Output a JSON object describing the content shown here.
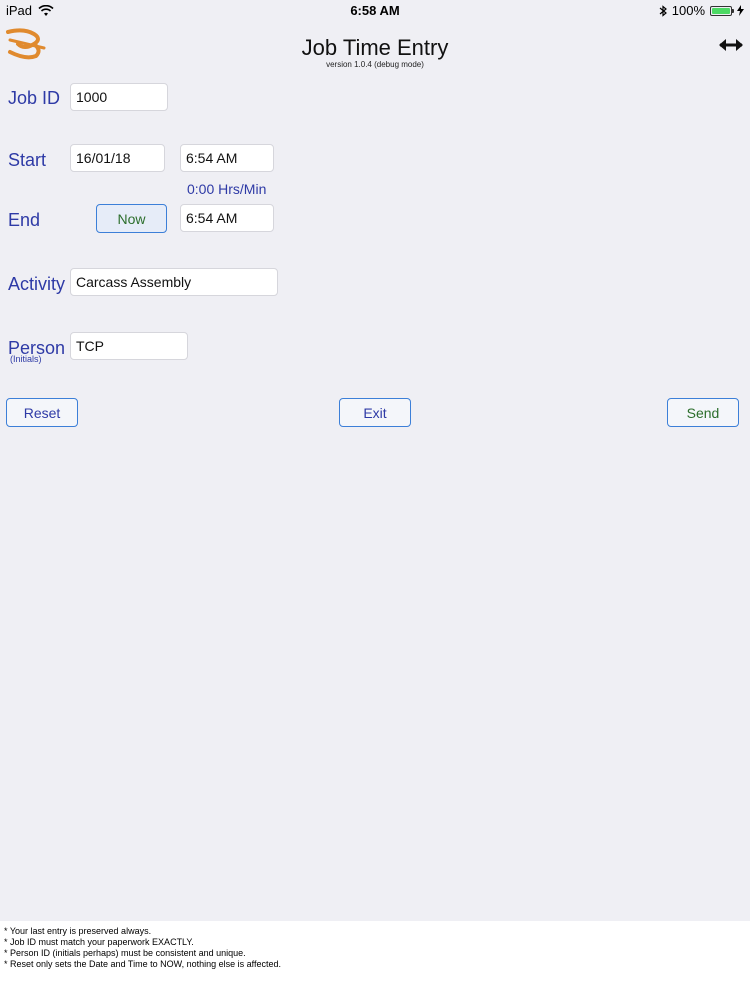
{
  "status_bar": {
    "device": "iPad",
    "time": "6:58 AM",
    "battery": "100%",
    "battery_level": 1.0
  },
  "header": {
    "title": "Job Time Entry",
    "subtitle": "version 1.0.4 (debug mode)"
  },
  "form": {
    "job_id": {
      "label": "Job ID",
      "value": "1000"
    },
    "start": {
      "label": "Start",
      "date": "16/01/18",
      "time": "6:54 AM"
    },
    "duration": "0:00 Hrs/Min",
    "end": {
      "label": "End",
      "now_label": "Now",
      "time": "6:54 AM"
    },
    "activity": {
      "label": "Activity",
      "value": "Carcass Assembly"
    },
    "person": {
      "label": "Person",
      "sublabel": "(Initials)",
      "value": "TCP"
    }
  },
  "actions": {
    "reset": "Reset",
    "exit": "Exit",
    "send": "Send"
  },
  "footer": {
    "notes": [
      "* Your last entry is preserved always.",
      "* Job ID must match your paperwork EXACTLY.",
      "* Person ID (initials perhaps) must be consistent and unique.",
      "* Reset only sets the Date and Time to NOW, nothing else is affected."
    ]
  },
  "colors": {
    "label_blue": "#2e3aa6",
    "button_border": "#3c7fd8",
    "send_green": "#2c6e2c",
    "logo_orange": "#e08a2e",
    "background": "#efeff4"
  }
}
